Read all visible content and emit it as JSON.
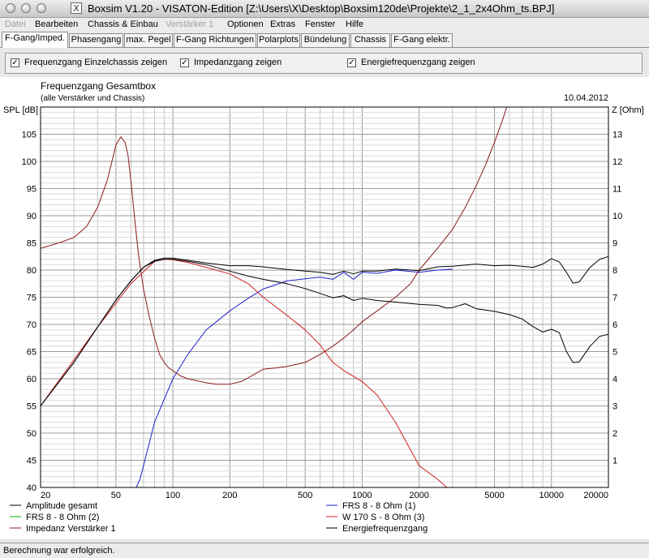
{
  "window": {
    "title": "Boxsim V1.20 - VISATON-Edition [Z:\\Users\\X\\Desktop\\Boxsim120de\\Projekte\\2_1_2x4Ohm_ts.BPJ]"
  },
  "menu": {
    "items": [
      {
        "label": "Datei",
        "enabled": false
      },
      {
        "label": "Bearbeiten",
        "enabled": true
      },
      {
        "label": "Chassis & Einbau",
        "enabled": true
      },
      {
        "label": "Verstärker 1",
        "enabled": false
      },
      {
        "label": "Optionen",
        "enabled": true
      },
      {
        "label": "Extras",
        "enabled": true
      },
      {
        "label": "Fenster",
        "enabled": true
      },
      {
        "label": "Hilfe",
        "enabled": true
      }
    ]
  },
  "tabs": [
    {
      "label": "F-Gang/Imped.",
      "active": true
    },
    {
      "label": "Phasengang",
      "active": false
    },
    {
      "label": "max. Pegel",
      "active": false
    },
    {
      "label": "F-Gang Richtungen",
      "active": false
    },
    {
      "label": "Polarplots",
      "active": false
    },
    {
      "label": "Bündelung",
      "active": false
    },
    {
      "label": "Chassis",
      "active": false
    },
    {
      "label": "F-Gang elektr.",
      "active": false
    }
  ],
  "options": [
    {
      "label": "Frequenzgang Einzelchassis zeigen",
      "checked": true
    },
    {
      "label": "Impedanzgang zeigen",
      "checked": true
    },
    {
      "label": "Energiefrequenzgang zeigen",
      "checked": true
    }
  ],
  "status": {
    "text": "Berechnung war erfolgreich."
  },
  "chart_data": {
    "type": "line",
    "title": "Frequenzgang Gesamtbox",
    "subtitle": "(alle Verstärker und Chassis)",
    "date": "10.04.2012",
    "ylabel": "SPL [dB]",
    "y2label": "Z [Ohm]",
    "xscale": "log",
    "xlim": [
      20,
      20000
    ],
    "ylim": [
      40,
      110
    ],
    "y2lim": [
      0,
      14
    ],
    "xticks": [
      20,
      50,
      100,
      200,
      500,
      1000,
      2000,
      5000,
      10000,
      20000
    ],
    "xtick_labels": [
      "20",
      "50",
      "100",
      "200",
      "500",
      "1000",
      "2000",
      "5000",
      "10000",
      "20000"
    ],
    "yticks": [
      40,
      45,
      50,
      55,
      60,
      65,
      70,
      75,
      80,
      85,
      90,
      95,
      100,
      105
    ],
    "y2ticks": [
      1,
      2,
      3,
      4,
      5,
      6,
      7,
      8,
      9,
      10,
      11,
      12,
      13
    ],
    "grid": true,
    "legend_position": "bottom",
    "series": [
      {
        "name": "Amplitude gesamt",
        "axis": "left",
        "color": "#000000",
        "x": [
          20,
          30,
          40,
          50,
          60,
          70,
          80,
          90,
          100,
          120,
          150,
          200,
          250,
          300,
          400,
          500,
          600,
          700,
          800,
          900,
          1000,
          1200,
          1500,
          2000,
          2500,
          3000,
          4000,
          5000,
          6000,
          7000,
          8000,
          9000,
          10000,
          11000,
          12000,
          13000,
          14000,
          16000,
          18000,
          20000
        ],
        "y": [
          55,
          63,
          69.5,
          74.5,
          78,
          80.5,
          81.8,
          82.2,
          82.2,
          81.8,
          81.3,
          80.8,
          80.8,
          80.6,
          80.1,
          79.8,
          79.6,
          79.2,
          79.8,
          79.3,
          79.8,
          79.8,
          80.2,
          79.9,
          80.6,
          80.7,
          81.1,
          80.8,
          80.9,
          80.7,
          80.5,
          81.1,
          82.1,
          81.5,
          79.6,
          77.6,
          77.8,
          80.5,
          82,
          82.5
        ]
      },
      {
        "name": "FRS 8 - 8 Ohm (1)",
        "axis": "left",
        "color": "#2020d0",
        "x": [
          64,
          67,
          70,
          80,
          100,
          120,
          150,
          200,
          250,
          300,
          400,
          500,
          600,
          700,
          800,
          900,
          1000,
          1200,
          1500,
          2000,
          2500,
          3000
        ],
        "y": [
          40,
          41.5,
          44,
          52,
          60,
          64.5,
          69,
          72.5,
          74.8,
          76.5,
          78,
          78.4,
          78.7,
          78.3,
          79.6,
          78.3,
          79.6,
          79.4,
          80,
          79.6,
          80,
          80.2
        ]
      },
      {
        "name": "FRS 8 - 8 Ohm (2)",
        "axis": "left",
        "color": "#00b000",
        "x": [
          20,
          20000
        ],
        "y": [
          40,
          40
        ]
      },
      {
        "name": "W 170 S - 8 Ohm (3)",
        "axis": "left",
        "color": "#d02020",
        "x": [
          20,
          40,
          60,
          80,
          90,
          100,
          120,
          150,
          200,
          250,
          300,
          400,
          500,
          600,
          700,
          800,
          1000,
          1200,
          1500,
          2000,
          2500,
          2800
        ],
        "y": [
          55,
          69.5,
          77.5,
          81.6,
          82,
          81.9,
          81.4,
          80.5,
          79.3,
          77.5,
          75,
          71.7,
          69,
          66.2,
          63,
          61.5,
          59.5,
          57,
          52,
          44,
          41.5,
          40
        ]
      },
      {
        "name": "Impedanz Verstärker 1",
        "axis": "right",
        "color": "#8b1a1a",
        "x": [
          20,
          25,
          30,
          35,
          40,
          45,
          50,
          53,
          56,
          58,
          60,
          63,
          66,
          70,
          75,
          80,
          85,
          90,
          95,
          100,
          110,
          120,
          130,
          150,
          170,
          200,
          230,
          260,
          300,
          350,
          400,
          500,
          600,
          700,
          800,
          900,
          1000,
          1200,
          1500,
          1800,
          2000,
          2500,
          3000,
          3500,
          4000,
          4500,
          5000,
          5500,
          5800,
          6000,
          20000
        ],
        "y": [
          8.8,
          9.0,
          9.2,
          9.6,
          10.3,
          11.3,
          12.6,
          12.9,
          12.7,
          12.2,
          11.3,
          9.8,
          8.5,
          7.3,
          6.3,
          5.5,
          4.9,
          4.6,
          4.4,
          4.3,
          4.1,
          4.0,
          3.95,
          3.85,
          3.8,
          3.8,
          3.9,
          4.1,
          4.35,
          4.4,
          4.45,
          4.6,
          4.9,
          5.2,
          5.5,
          5.8,
          6.1,
          6.5,
          7.0,
          7.5,
          8.0,
          8.8,
          9.5,
          10.3,
          11.1,
          11.9,
          12.7,
          13.5,
          14,
          14,
          14
        ]
      },
      {
        "name": "Energiefrequenzgang",
        "axis": "left",
        "color": "#000000",
        "x": [
          20,
          30,
          40,
          50,
          60,
          70,
          80,
          90,
          100,
          120,
          150,
          200,
          250,
          300,
          400,
          500,
          600,
          700,
          800,
          900,
          1000,
          1200,
          1500,
          2000,
          2500,
          2800,
          3000,
          3500,
          4000,
          5000,
          6000,
          7000,
          8000,
          9000,
          10000,
          11000,
          12000,
          13000,
          14000,
          16000,
          18000,
          20000
        ],
        "y": [
          55,
          63,
          69.5,
          74.5,
          78,
          80.5,
          81.6,
          82,
          82,
          81.6,
          81,
          79.8,
          78.9,
          78.3,
          77.5,
          76.6,
          75.7,
          74.9,
          75.3,
          74.4,
          74.8,
          74.4,
          74.1,
          73.7,
          73.5,
          73,
          73.1,
          73.8,
          72.9,
          72.4,
          71.8,
          71,
          69.6,
          68.6,
          69.1,
          68.5,
          65,
          63,
          63.1,
          66,
          67.8,
          68.2
        ]
      }
    ]
  }
}
